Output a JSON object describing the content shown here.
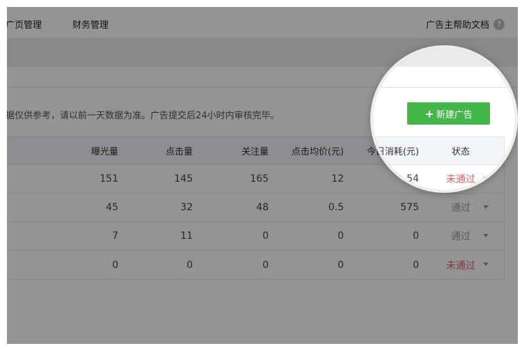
{
  "nav": {
    "item1": "广页管理",
    "item2": "财务管理",
    "help": "广告主帮助文档",
    "help_icon": "?"
  },
  "notice": "据仅供参考，请以前一天数据为准。广告提交后24小时内审核完毕。",
  "new_button": {
    "plus": "+",
    "label": "新建广告"
  },
  "table": {
    "headers": [
      "曝光量",
      "点击量",
      "关注量",
      "点击均价(元)",
      "今日消耗(元)",
      "状态"
    ],
    "rows": [
      {
        "impressions": "151",
        "clicks": "145",
        "follows": "165",
        "cpc": "12",
        "spend": "54",
        "status": "未通过"
      },
      {
        "impressions": "45",
        "clicks": "32",
        "follows": "48",
        "cpc": "0.5",
        "spend": "575",
        "status": "通过"
      },
      {
        "impressions": "7",
        "clicks": "11",
        "follows": "0",
        "cpc": "0",
        "spend": "0",
        "status": "通过"
      },
      {
        "impressions": "0",
        "clicks": "0",
        "follows": "0",
        "cpc": "0",
        "spend": "0",
        "status": "未通过"
      }
    ]
  },
  "colors": {
    "accent_green": "#44b549",
    "fail_red": "#e15f63",
    "overlay": "rgba(0,0,0,0.42)"
  }
}
